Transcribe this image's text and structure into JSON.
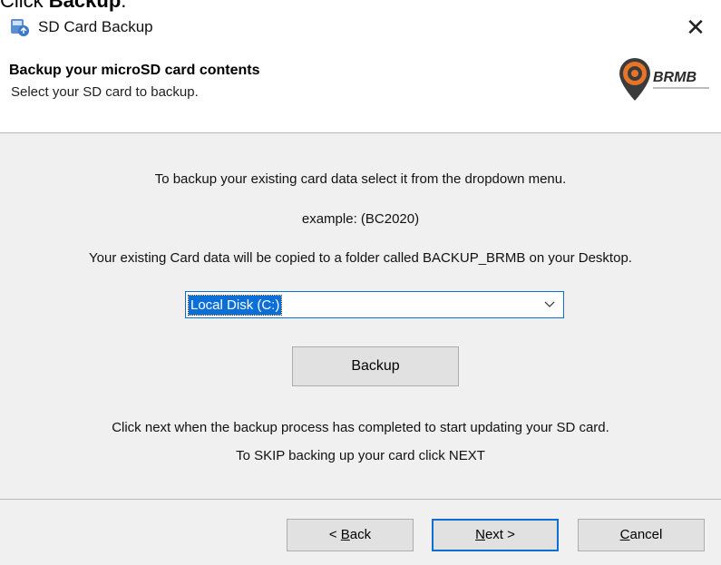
{
  "instruction": {
    "prefix": "Click ",
    "bold": "Backup",
    "suffix": "."
  },
  "window": {
    "title": "SD Card Backup",
    "close_glyph": "✕"
  },
  "header": {
    "title": "Backup your microSD card contents",
    "subtitle": "Select your SD card to backup.",
    "logo_text": "BRMB"
  },
  "body": {
    "line1": "To backup your existing card data select it from the dropdown menu.",
    "line2": "example: (BC2020)",
    "line3": "Your existing Card data will be copied to a folder called BACKUP_BRMB on your Desktop.",
    "dropdown_value": "Local Disk (C:)",
    "backup_button": "Backup",
    "line4": "Click next when the backup process has completed to start updating your SD card.",
    "line5": "To SKIP backing up your card click NEXT"
  },
  "footer": {
    "back": {
      "prefix": "< ",
      "key": "B",
      "rest": "ack"
    },
    "next": {
      "key": "N",
      "rest": "ext >"
    },
    "cancel": {
      "key": "C",
      "rest": "ancel"
    }
  },
  "colors": {
    "accent": "#0c6fd1",
    "panel": "#f0f0f0",
    "button": "#e1e1e1",
    "logo_orange": "#e8742a"
  }
}
